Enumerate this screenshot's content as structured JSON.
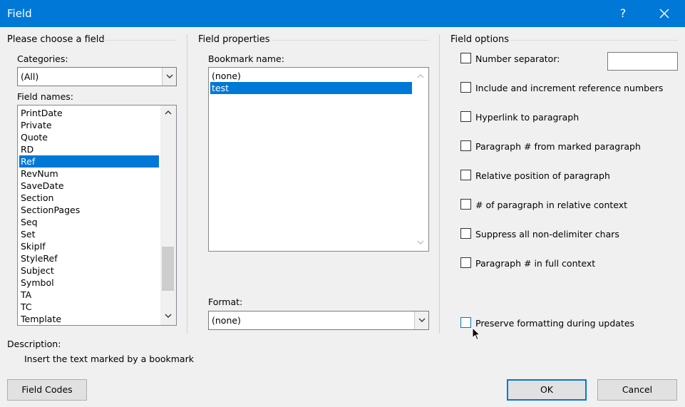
{
  "window": {
    "title": "Field",
    "help": "?"
  },
  "choose": {
    "group_title": "Please choose a field",
    "categories_label": "Categories:",
    "categories_value": "(All)",
    "field_names_label": "Field names:",
    "field_names": [
      "PrintDate",
      "Private",
      "Quote",
      "RD",
      "Ref",
      "RevNum",
      "SaveDate",
      "Section",
      "SectionPages",
      "Seq",
      "Set",
      "SkipIf",
      "StyleRef",
      "Subject",
      "Symbol",
      "TA",
      "TC",
      "Template"
    ],
    "selected_field": "Ref"
  },
  "properties": {
    "group_title": "Field properties",
    "bookmark_label": "Bookmark name:",
    "bookmarks": [
      "(none)",
      "test"
    ],
    "selected_bookmark": "test",
    "format_label": "Format:",
    "format_value": "(none)"
  },
  "options": {
    "group_title": "Field options",
    "items": [
      {
        "label": "Number separator:",
        "checked": false
      },
      {
        "label": "Include and increment reference numbers",
        "checked": false
      },
      {
        "label": "Hyperlink to paragraph",
        "checked": false
      },
      {
        "label": "Paragraph # from marked paragraph",
        "checked": false
      },
      {
        "label": "Relative position of paragraph",
        "checked": false
      },
      {
        "label": "# of paragraph in relative context",
        "checked": false
      },
      {
        "label": "Suppress all non-delimiter chars",
        "checked": false
      },
      {
        "label": "Paragraph # in full context",
        "checked": false
      }
    ],
    "number_separator_value": "",
    "preserve_label": "Preserve formatting during updates",
    "preserve_checked": false
  },
  "description": {
    "label": "Description:",
    "text": "Insert the text marked by a bookmark"
  },
  "buttons": {
    "field_codes": "Field Codes",
    "ok": "OK",
    "cancel": "Cancel"
  },
  "colors": {
    "titlebar": "#0078d7",
    "selection": "#0078d7",
    "dialog_bg": "#f0f0f0"
  }
}
